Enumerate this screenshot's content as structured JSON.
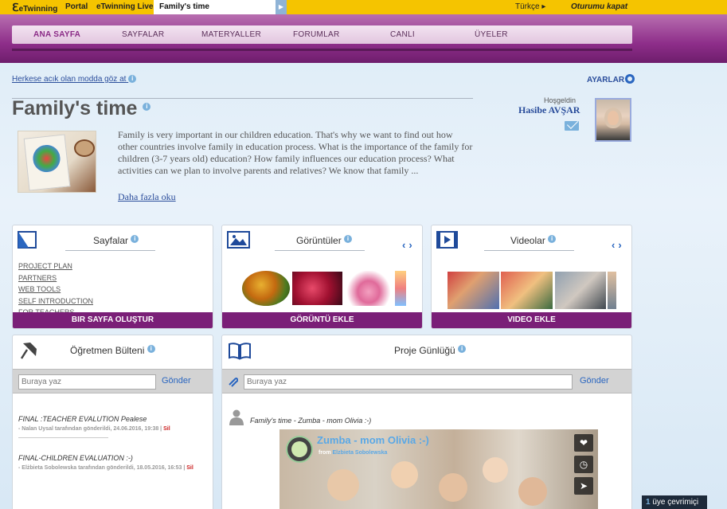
{
  "topbar": {
    "logo_text": "eTwinning",
    "links": [
      "Portal",
      "eTwinning Live"
    ],
    "active_tab": "Family's time",
    "language": "Türkçe",
    "logout": "Oturumu kapat"
  },
  "nav": {
    "items": [
      "ANA SAYFA",
      "SAYFALAR",
      "MATERYALLER",
      "FORUMLAR",
      "CANLI",
      "ÜYELER"
    ]
  },
  "header": {
    "public_link": "Herkese acık olan modda göz at",
    "settings": "AYARLAR",
    "title": "Family's time",
    "welcome": "Hoşgeldin",
    "user_name": "Hasibe AVŞAR",
    "description": "Family is very important in our children education. That's why we want to find out how other countries involve family in education process. What is the importance of the family for children (3-7 years old) education? How family influences our education process? What activities can we plan to involve parents and relatives? We know that family ...",
    "read_more": "Daha fazla oku"
  },
  "pages_panel": {
    "title": "Sayfalar",
    "items": [
      "PROJECT PLAN",
      "PARTNERS",
      "WEB TOOLS",
      "SELF INTRODUCTION",
      "FOR TEACHERS"
    ],
    "button": "BIR SAYFA OLUŞTUR"
  },
  "images_panel": {
    "title": "Görüntüler",
    "button": "GÖRÜNTÜ EKLE"
  },
  "videos_panel": {
    "title": "Videolar",
    "button": "VIDEO EKLE"
  },
  "teacher_bulletin": {
    "title": "Öğretmen Bülteni",
    "placeholder": "Buraya yaz",
    "send": "Gönder",
    "posts": [
      {
        "text": "FINAL :TEACHER EVALUTION Pealese",
        "meta": "- Nalan Uysal tarafından gönderildi, 24.06.2016, 19:38 |",
        "delete": "Sil"
      },
      {
        "text": "FINAL-CHILDREN EVALUATION :-)",
        "meta": "- Elżbieta Sobolewska tarafından gönderildi, 18.05.2016, 16:53 |",
        "delete": "Sil"
      }
    ]
  },
  "project_diary": {
    "title": "Proje Günlüğü",
    "placeholder": "Buraya yaz",
    "send": "Gönder",
    "entry_title": "Family's time - Zumba - mom Olivia :-)",
    "video": {
      "title": "Zumba - mom Olivia :-)",
      "from_label": "from",
      "author": "Elzbieta Sobolewska"
    }
  },
  "status": {
    "online_count": "1",
    "online_label": "üye çevrimiçi"
  }
}
